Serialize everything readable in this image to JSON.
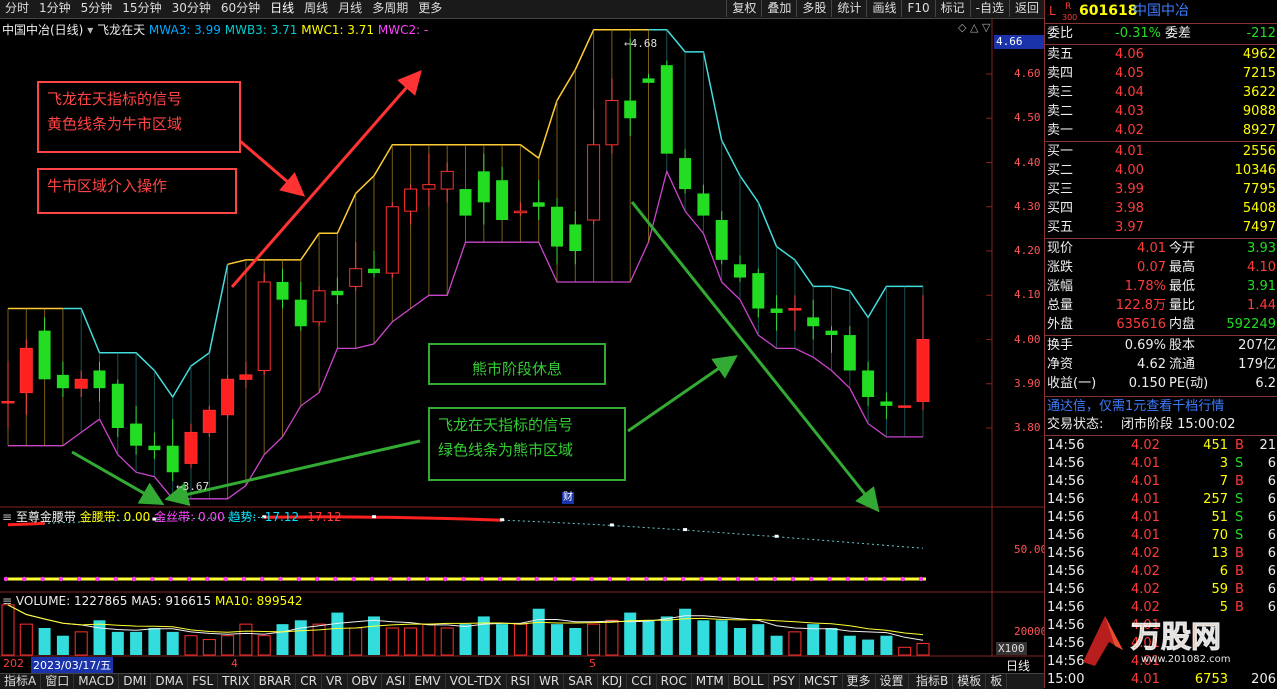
{
  "toolbar": {
    "periods": [
      "分时",
      "1分钟",
      "5分钟",
      "15分钟",
      "30分钟",
      "60分钟",
      "日线",
      "周线",
      "月线",
      "多周期",
      "更多"
    ],
    "active_period": "日线",
    "tools": [
      "复权",
      "叠加",
      "多股",
      "统计",
      "画线",
      "F10",
      "标记",
      "-自选",
      "返回"
    ]
  },
  "chart_header": {
    "stock": "中国中冶(日线)",
    "indicator": "飞龙在天",
    "mwa3": "MWA3: 3.99",
    "mwb3": "MWB3: 3.71",
    "mwc1": "MWC1: 3.71",
    "mwc2": "MWC2: -"
  },
  "price_axis": [
    "4.60",
    "4.50",
    "4.40",
    "4.30",
    "4.20",
    "4.10",
    "4.00",
    "3.90",
    "3.80"
  ],
  "price_badge": "4.66",
  "high_label": "4.68",
  "low_label": "3.67",
  "finance_marker": "财",
  "annotations": {
    "bull_signal_line1": "飞龙在天指标的信号",
    "bull_signal_line2": "黄色线条为牛市区域",
    "bull_action": "牛市区域介入操作",
    "bear_rest": "熊市阶段休息",
    "bear_signal_line1": "飞龙在天指标的信号",
    "bear_signal_line2": "绿色线条为熊市区域"
  },
  "indicator_panel": {
    "name": "至尊金腰带",
    "gold_belt": "金腰带: 0.00",
    "gold_silk": "金丝带: 0.00",
    "trend": "趋势: -17.12",
    "trend2": "-17.12",
    "axis_label": "50.00"
  },
  "volume_panel": {
    "volume": "VOLUME: 1227865",
    "ma5": "MA5: 916615",
    "ma10": "MA10: 899542",
    "axis_label": "20000",
    "unit": "X100"
  },
  "date_bar": {
    "year_prefix": "202",
    "date": "2023/03/17/五",
    "month4": "4",
    "month5": "5",
    "period": "日线"
  },
  "bottom_tabs": [
    "指标A",
    "窗口",
    "MACD",
    "DMI",
    "DMA",
    "FSL",
    "TRIX",
    "BRAR",
    "CR",
    "VR",
    "OBV",
    "ASI",
    "EMV",
    "VOL-TDX",
    "RSI",
    "WR",
    "SAR",
    "KDJ",
    "CCI",
    "ROC",
    "MTM",
    "BOLL",
    "PSY",
    "MCST",
    "更多",
    "设置"
  ],
  "bottom_right_tabs": [
    "指标B",
    "模板",
    "板"
  ],
  "quote": {
    "code": "601618",
    "name": "中国中冶",
    "flag_l": "L",
    "flag_r": "R",
    "flag_num": "300",
    "webi_label": "委比",
    "webi_value": "-0.31%",
    "weicha_label": "委差",
    "weicha_value": "-212",
    "asks": [
      {
        "label": "卖五",
        "price": "4.06",
        "vol": "4962"
      },
      {
        "label": "卖四",
        "price": "4.05",
        "vol": "7215"
      },
      {
        "label": "卖三",
        "price": "4.04",
        "vol": "3622"
      },
      {
        "label": "卖二",
        "price": "4.03",
        "vol": "9088"
      },
      {
        "label": "卖一",
        "price": "4.02",
        "vol": "8927"
      }
    ],
    "bids": [
      {
        "label": "买一",
        "price": "4.01",
        "vol": "2556"
      },
      {
        "label": "买二",
        "price": "4.00",
        "vol": "10346"
      },
      {
        "label": "买三",
        "price": "3.99",
        "vol": "7795"
      },
      {
        "label": "买四",
        "price": "3.98",
        "vol": "5408"
      },
      {
        "label": "买五",
        "price": "3.97",
        "vol": "7497"
      }
    ],
    "stats": [
      {
        "l1": "现价",
        "v1": "4.01",
        "l2": "今开",
        "v2": "3.93"
      },
      {
        "l1": "涨跌",
        "v1": "0.07",
        "l2": "最高",
        "v2": "4.10"
      },
      {
        "l1": "涨幅",
        "v1": "1.78%",
        "l2": "最低",
        "v2": "3.91"
      },
      {
        "l1": "总量",
        "v1": "122.8万",
        "l2": "量比",
        "v2": "1.44"
      },
      {
        "l1": "外盘",
        "v1": "635616",
        "l2": "内盘",
        "v2": "592249"
      }
    ],
    "stats2": [
      {
        "l1": "换手",
        "v1": "0.69%",
        "l2": "股本",
        "v2": "207亿"
      },
      {
        "l1": "净资",
        "v1": "4.62",
        "l2": "流通",
        "v2": "179亿"
      },
      {
        "l1": "收益(一)",
        "v1": "0.150",
        "l2": "PE(动)",
        "v2": "6.2"
      }
    ],
    "ad": "通达信，仅需1元查看千档行情",
    "trade_status_label": "交易状态:",
    "trade_status": "闭市阶段 15:00:02",
    "ticks": [
      {
        "t": "14:56",
        "p": "4.02",
        "v": "451",
        "s": "B",
        "n": "21"
      },
      {
        "t": "14:56",
        "p": "4.01",
        "v": "3",
        "s": "S",
        "n": "6"
      },
      {
        "t": "14:56",
        "p": "4.01",
        "v": "7",
        "s": "B",
        "n": "6"
      },
      {
        "t": "14:56",
        "p": "4.01",
        "v": "257",
        "s": "S",
        "n": "6"
      },
      {
        "t": "14:56",
        "p": "4.01",
        "v": "51",
        "s": "S",
        "n": "6"
      },
      {
        "t": "14:56",
        "p": "4.01",
        "v": "70",
        "s": "S",
        "n": "6"
      },
      {
        "t": "14:56",
        "p": "4.02",
        "v": "13",
        "s": "B",
        "n": "6"
      },
      {
        "t": "14:56",
        "p": "4.02",
        "v": "6",
        "s": "B",
        "n": "6"
      },
      {
        "t": "14:56",
        "p": "4.02",
        "v": "59",
        "s": "B",
        "n": "6"
      },
      {
        "t": "14:56",
        "p": "4.02",
        "v": "5",
        "s": "B",
        "n": "6"
      },
      {
        "t": "14:56",
        "p": "4.01",
        "v": "",
        "s": "",
        "n": ""
      },
      {
        "t": "14:56",
        "p": "4.01",
        "v": "",
        "s": "",
        "n": ""
      },
      {
        "t": "14:56",
        "p": "4.01",
        "v": "",
        "s": "",
        "n": ""
      },
      {
        "t": "15:00",
        "p": "4.01",
        "v": "6753",
        "s": "",
        "n": "206"
      }
    ],
    "watermark_brand": "万股网",
    "watermark_url": "www.201082.com"
  },
  "candles": [
    {
      "o": 3.86,
      "h": 3.95,
      "l": 3.8,
      "c": 3.86,
      "hl": [
        3.8,
        3.95
      ]
    },
    {
      "o": 3.88,
      "h": 4.0,
      "l": 3.83,
      "c": 3.98
    },
    {
      "o": 4.02,
      "h": 4.05,
      "l": 3.92,
      "c": 3.91
    },
    {
      "o": 3.92,
      "h": 3.95,
      "l": 3.87,
      "c": 3.89
    },
    {
      "o": 3.89,
      "h": 3.93,
      "l": 3.87,
      "c": 3.91
    },
    {
      "o": 3.93,
      "h": 3.95,
      "l": 3.86,
      "c": 3.89
    },
    {
      "o": 3.9,
      "h": 3.91,
      "l": 3.78,
      "c": 3.8
    },
    {
      "o": 3.81,
      "h": 3.85,
      "l": 3.74,
      "c": 3.76
    },
    {
      "o": 3.76,
      "h": 3.79,
      "l": 3.73,
      "c": 3.75
    },
    {
      "o": 3.76,
      "h": 3.82,
      "l": 3.68,
      "c": 3.7
    },
    {
      "o": 3.72,
      "h": 3.81,
      "l": 3.71,
      "c": 3.79
    },
    {
      "o": 3.79,
      "h": 3.85,
      "l": 3.78,
      "c": 3.84
    },
    {
      "o": 3.83,
      "h": 3.92,
      "l": 3.82,
      "c": 3.91
    },
    {
      "o": 3.91,
      "h": 3.95,
      "l": 3.89,
      "c": 3.92
    },
    {
      "o": 3.93,
      "h": 4.15,
      "l": 3.92,
      "c": 4.13
    },
    {
      "o": 4.13,
      "h": 4.16,
      "l": 4.07,
      "c": 4.09
    },
    {
      "o": 4.09,
      "h": 4.13,
      "l": 4.02,
      "c": 4.03
    },
    {
      "o": 4.04,
      "h": 4.12,
      "l": 4.03,
      "c": 4.11
    },
    {
      "o": 4.11,
      "h": 4.14,
      "l": 4.08,
      "c": 4.1
    },
    {
      "o": 4.12,
      "h": 4.22,
      "l": 4.11,
      "c": 4.16
    },
    {
      "o": 4.16,
      "h": 4.2,
      "l": 4.14,
      "c": 4.15
    },
    {
      "o": 4.15,
      "h": 4.31,
      "l": 4.14,
      "c": 4.3
    },
    {
      "o": 4.29,
      "h": 4.35,
      "l": 4.26,
      "c": 4.34
    },
    {
      "o": 4.34,
      "h": 4.42,
      "l": 4.3,
      "c": 4.35
    },
    {
      "o": 4.34,
      "h": 4.4,
      "l": 4.31,
      "c": 4.38
    },
    {
      "o": 4.34,
      "h": 4.3,
      "l": 4.3,
      "c": 4.28
    },
    {
      "o": 4.38,
      "h": 4.42,
      "l": 4.26,
      "c": 4.31
    },
    {
      "o": 4.36,
      "h": 4.39,
      "l": 4.27,
      "c": 4.27
    },
    {
      "o": 4.29,
      "h": 4.31,
      "l": 4.28,
      "c": 4.29
    },
    {
      "o": 4.31,
      "h": 4.36,
      "l": 4.27,
      "c": 4.3
    },
    {
      "o": 4.3,
      "h": 4.32,
      "l": 4.17,
      "c": 4.21
    },
    {
      "o": 4.26,
      "h": 4.29,
      "l": 4.17,
      "c": 4.2
    },
    {
      "o": 4.27,
      "h": 4.52,
      "l": 4.26,
      "c": 4.44
    },
    {
      "o": 4.44,
      "h": 4.59,
      "l": 4.42,
      "c": 4.54
    },
    {
      "o": 4.54,
      "h": 4.68,
      "l": 4.46,
      "c": 4.5
    },
    {
      "o": 4.59,
      "h": 4.6,
      "l": 4.58,
      "c": 4.58
    },
    {
      "o": 4.62,
      "h": 4.63,
      "l": 4.42,
      "c": 4.42
    },
    {
      "o": 4.41,
      "h": 4.43,
      "l": 4.33,
      "c": 4.34
    },
    {
      "o": 4.33,
      "h": 4.35,
      "l": 4.28,
      "c": 4.28
    },
    {
      "o": 4.27,
      "h": 4.29,
      "l": 4.17,
      "c": 4.18
    },
    {
      "o": 4.17,
      "h": 4.19,
      "l": 4.13,
      "c": 4.14
    },
    {
      "o": 4.15,
      "h": 4.16,
      "l": 4.05,
      "c": 4.07
    },
    {
      "o": 4.07,
      "h": 4.1,
      "l": 4.02,
      "c": 4.06
    },
    {
      "o": 4.07,
      "h": 4.1,
      "l": 4.02,
      "c": 4.07
    },
    {
      "o": 4.05,
      "h": 4.09,
      "l": 4.0,
      "c": 4.03
    },
    {
      "o": 4.02,
      "h": 4.03,
      "l": 3.97,
      "c": 4.01
    },
    {
      "o": 4.01,
      "h": 4.03,
      "l": 3.93,
      "c": 3.93
    },
    {
      "o": 3.93,
      "h": 3.95,
      "l": 3.85,
      "c": 3.87
    },
    {
      "o": 3.86,
      "h": 3.88,
      "l": 3.82,
      "c": 3.85
    },
    {
      "o": 3.85,
      "h": 3.85,
      "l": 3.85,
      "c": 3.85
    },
    {
      "o": 3.86,
      "h": 4.1,
      "l": 3.84,
      "c": 4.0
    }
  ],
  "volumes": [
    13,
    8,
    7,
    5,
    6,
    9,
    6,
    6,
    7,
    6,
    5,
    4,
    5,
    8,
    5,
    8,
    9,
    8,
    11,
    7,
    10,
    7,
    7,
    8,
    7,
    8,
    10,
    8,
    8,
    12,
    8,
    7,
    8,
    9,
    11,
    9,
    10,
    12,
    9,
    9,
    7,
    8,
    5,
    6,
    8,
    7,
    5,
    4,
    5,
    2,
    3
  ]
}
